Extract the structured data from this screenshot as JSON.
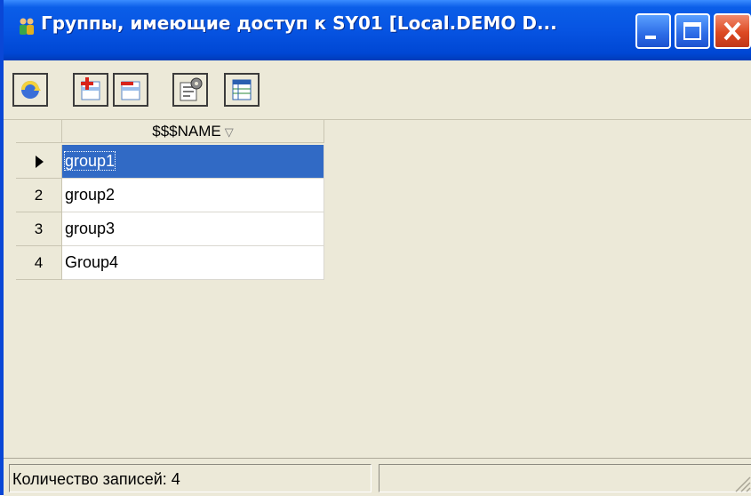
{
  "window": {
    "title": "Группы, имеющие доступ к SY01 [Local.DEMO D...",
    "icon": "groups-icon",
    "buttons": [
      "minimize-icon",
      "maximize-icon",
      "close-icon"
    ]
  },
  "toolbar": {
    "items": [
      "refresh-icon",
      "add-icon",
      "remove-icon",
      "properties-icon",
      "columns-icon"
    ]
  },
  "grid": {
    "column_header": "$$$NAME",
    "sort_indicator": "▽",
    "rows": [
      {
        "num": "",
        "value": "group1",
        "current": true,
        "selected": true
      },
      {
        "num": "2",
        "value": "group2",
        "current": false,
        "selected": false
      },
      {
        "num": "3",
        "value": "group3",
        "current": false,
        "selected": false
      },
      {
        "num": "4",
        "value": "Group4",
        "current": false,
        "selected": false
      }
    ]
  },
  "statusbar": {
    "record_count_text": "Количество записей: 4"
  },
  "colors": {
    "titlebar": "#0754e2",
    "selection": "#316ac5",
    "face": "#ece9d8"
  }
}
